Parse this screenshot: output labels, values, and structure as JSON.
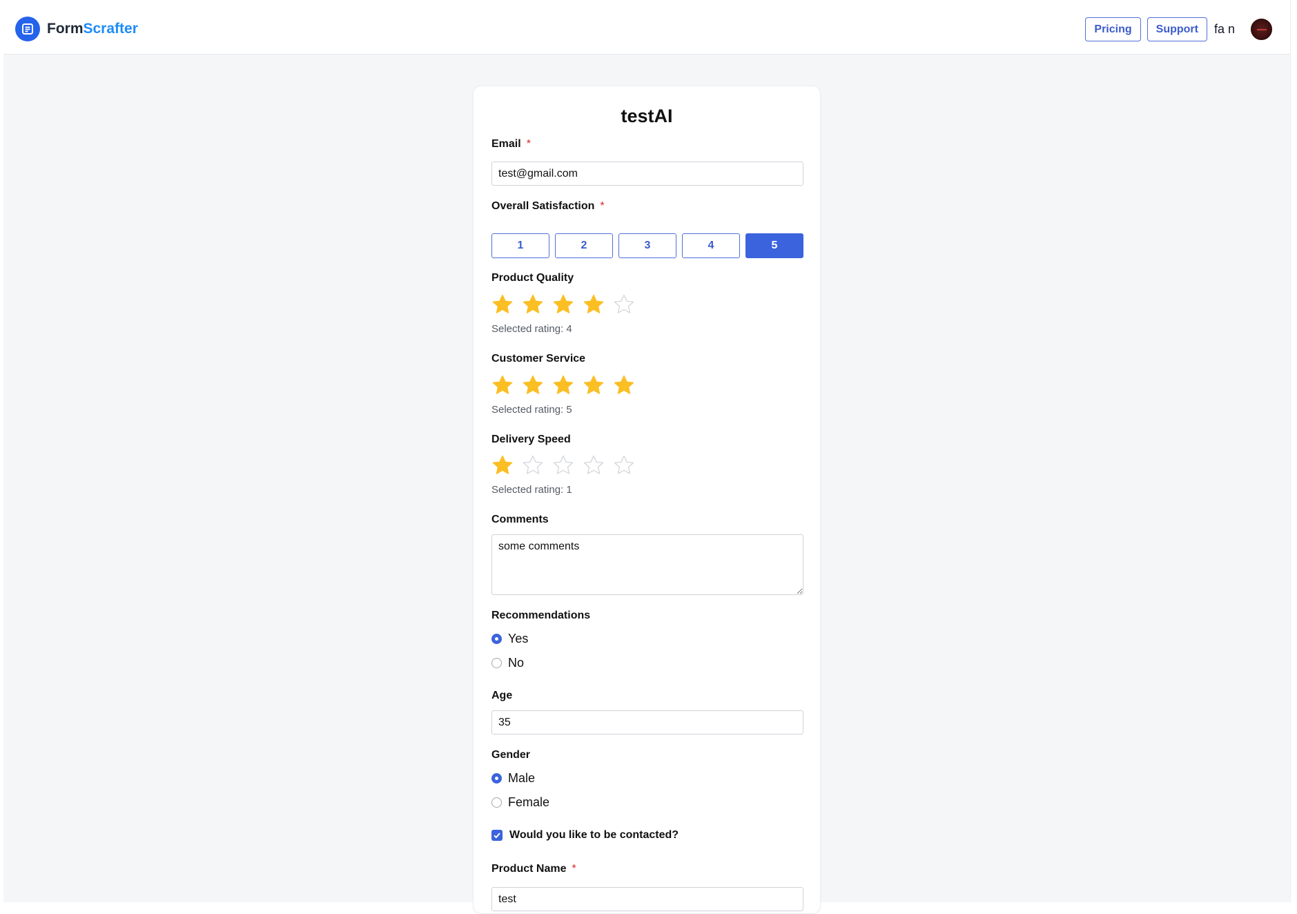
{
  "brand": {
    "name_part1": "Form",
    "name_part2": "Scrafter",
    "logo_icon": "document-lines-icon"
  },
  "nav": {
    "pricing": "Pricing",
    "support": "Support",
    "user_name": "fa n"
  },
  "colors": {
    "accent": "#3b63dd",
    "brand_blue": "#1d8cf8",
    "star_filled": "#fbbf24",
    "required": "#dc2626"
  },
  "form": {
    "title": "testAI",
    "email": {
      "label": "Email",
      "required_mark": "*",
      "value": "test@gmail.com"
    },
    "overall": {
      "label": "Overall Satisfaction",
      "required_mark": "*",
      "options": [
        "1",
        "2",
        "3",
        "4",
        "5"
      ],
      "selected": "5"
    },
    "quality": {
      "label": "Product Quality",
      "rating": 4,
      "max": 5,
      "note": "Selected rating: 4"
    },
    "service": {
      "label": "Customer Service",
      "rating": 5,
      "max": 5,
      "note": "Selected rating: 5"
    },
    "delivery": {
      "label": "Delivery Speed",
      "rating": 1,
      "max": 5,
      "note": "Selected rating: 1"
    },
    "comments": {
      "label": "Comments",
      "value": "some comments"
    },
    "recommend": {
      "label": "Recommendations",
      "options": [
        "Yes",
        "No"
      ],
      "selected": "Yes"
    },
    "age": {
      "label": "Age",
      "value": "35"
    },
    "gender": {
      "label": "Gender",
      "options": [
        "Male",
        "Female"
      ],
      "selected": "Male"
    },
    "contact": {
      "label": "Would you like to be contacted?",
      "checked": true
    },
    "product": {
      "label": "Product Name",
      "required_mark": "*",
      "value": "test"
    }
  }
}
